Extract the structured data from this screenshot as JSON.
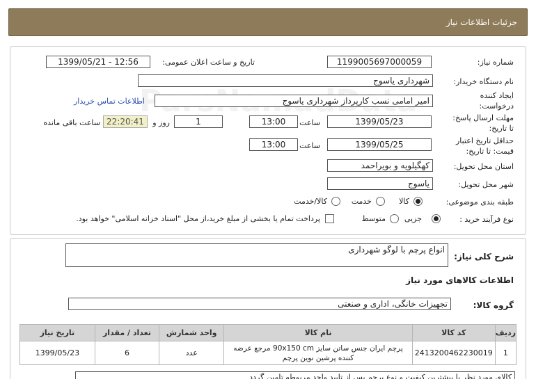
{
  "header": {
    "title": "جزئیات اطلاعات نیاز"
  },
  "form": {
    "need_number_label": "شماره نیاز:",
    "need_number": "1199005697000059",
    "announce_label": "تاریخ و ساعت اعلان عمومی:",
    "announce_value": "1399/05/21 - 12:56",
    "buyer_label": "نام دستگاه خریدار:",
    "buyer_value": "شهرداری یاسوج",
    "requester_label": "ایجاد کننده درخواست:",
    "requester_value": "امیر امامی نسب کارپرداز شهرداری یاسوج",
    "buyer_contact_link": "اطلاعات تماس خریدار",
    "deadline_label": "مهلت ارسال پاسخ: تا تاریخ:",
    "deadline_date": "1399/05/23",
    "time_label": "ساعت",
    "deadline_time": "13:00",
    "days_value": "1",
    "days_label": "روز و",
    "remaining_time": "22:20:41",
    "remaining_label": "ساعت باقی مانده",
    "validity_label": "حداقل تاریخ اعتبار قیمت: تا تاریخ:",
    "validity_date": "1399/05/25",
    "validity_time": "13:00",
    "province_label": "استان محل تحویل:",
    "province_value": "کهگیلویه و بویراحمد",
    "city_label": "شهر محل تحویل:",
    "city_value": "یاسوج",
    "category_label": "طبقه بندی موضوعی:",
    "category_options": [
      "کالا",
      "خدمت",
      "کالا/خدمت"
    ],
    "category_selected": "کالا",
    "process_label": "نوع فرآیند خرید :",
    "process_options": [
      "جزیی",
      "متوسط"
    ],
    "process_selected": "جزیی",
    "payment_note": "پرداخت تمام یا بخشی از مبلغ خرید،از محل \"اسناد خزانه اسلامی\" خواهد بود."
  },
  "summary": {
    "desc_label": "شرح کلی نیاز:",
    "desc_value": "انواع پرچم با لوگو شهرداری",
    "items_title": "اطلاعات کالاهای مورد نیاز",
    "group_label": "گروه کالا:",
    "group_value": "تجهیزات خانگی، اداری و صنعتی"
  },
  "table": {
    "headers": [
      "ردیف",
      "کد کالا",
      "نام کالا",
      "واحد شمارش",
      "تعداد / مقدار",
      "تاریخ نیاز"
    ],
    "rows": [
      [
        "1",
        "2413200462230019",
        "پرچم ایران جنس ساتن سایز 90x150 cm مرجع عرضه کننده پرشین نوین پرچم",
        "عدد",
        "6",
        "1399/05/23"
      ]
    ]
  },
  "footer": {
    "partial_text": "کالای مورد نظر با بیشترین کیفیت و نوع پرچم پس از تایید واحد مربوطه تامین گردد"
  },
  "watermark": {
    "text": "ParsNamadData",
    "phone": "۰۲۱-۸۸۳۴۹۶۷۰-۵"
  }
}
